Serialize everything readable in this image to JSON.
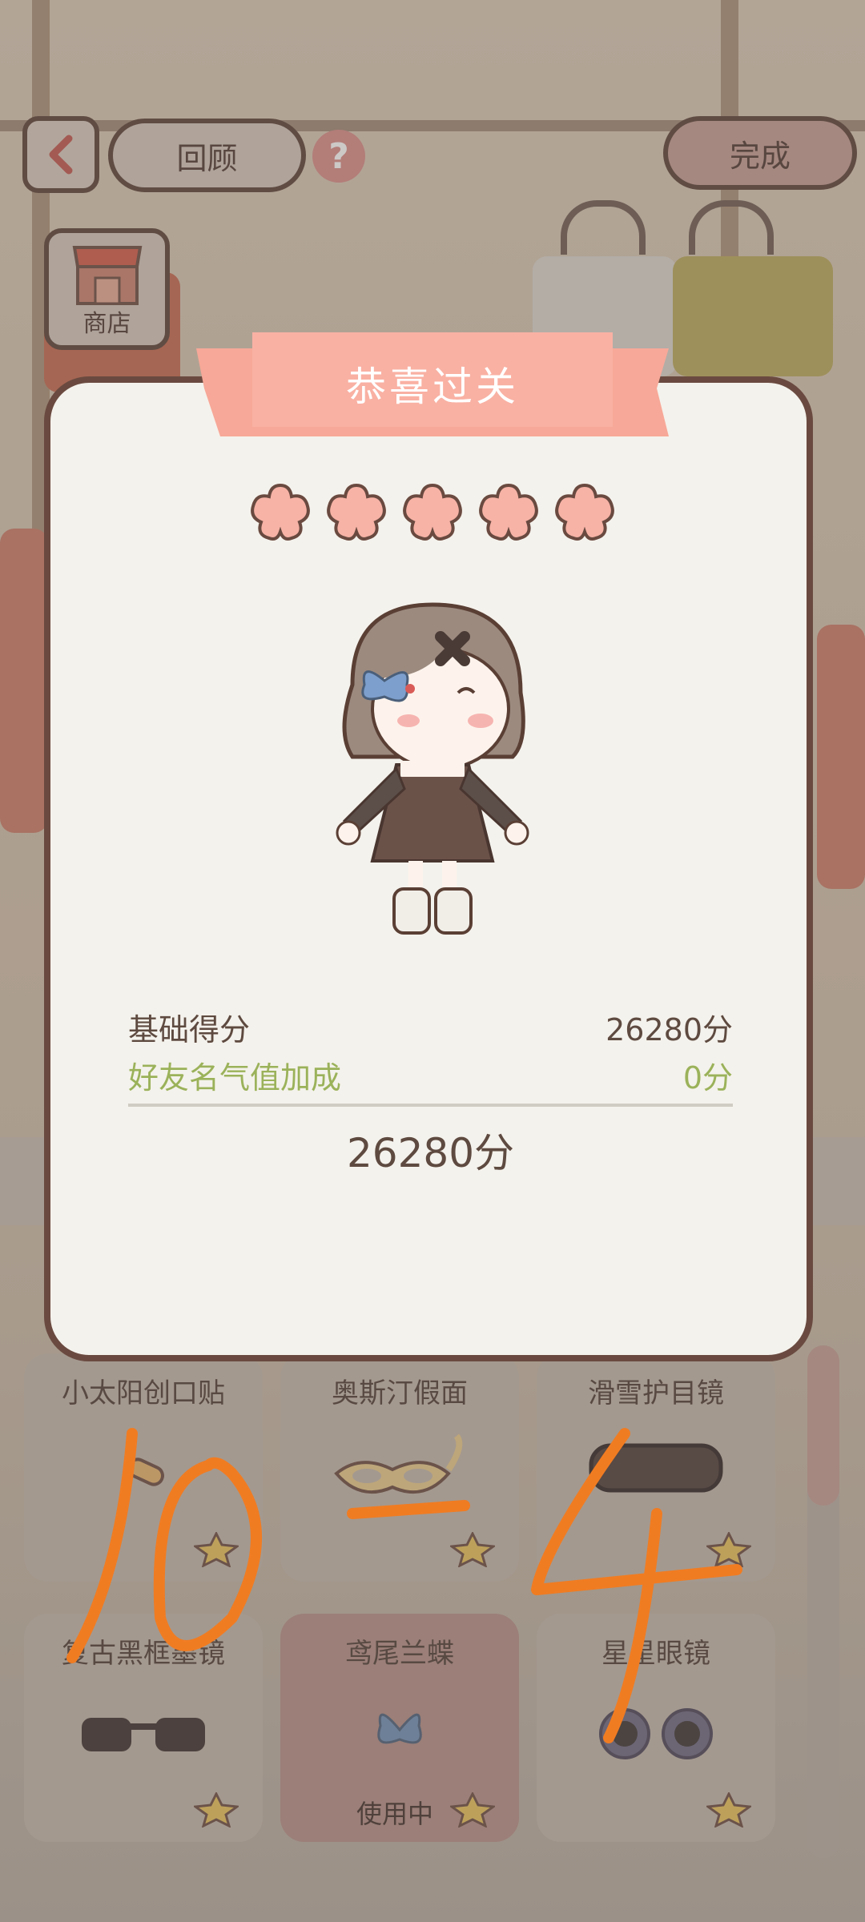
{
  "top_bar": {
    "review_label": "回顾",
    "help_symbol": "?",
    "done_label": "完成",
    "shop_label": "商店"
  },
  "dialog": {
    "title": "恭喜过关",
    "stars_earned": 5,
    "stars_total": 5,
    "base_score_label": "基础得分",
    "base_score_value": "26280分",
    "bonus_label": "好友名气值加成",
    "bonus_value": "0分",
    "total_value": "26280分"
  },
  "items": [
    {
      "name": "小太阳创口贴",
      "status": "",
      "icon": "bandage-icon"
    },
    {
      "name": "奥斯汀假面",
      "status": "",
      "icon": "mask-icon"
    },
    {
      "name": "滑雪护目镜",
      "status": "",
      "icon": "goggles-icon"
    },
    {
      "name": "复古黑框墨镜",
      "status": "",
      "icon": "sunglasses-icon"
    },
    {
      "name": "鸢尾兰蝶",
      "status": "使用中",
      "icon": "butterfly-clip-icon"
    },
    {
      "name": "星星眼镜",
      "status": "",
      "icon": "flower-glasses-icon"
    }
  ],
  "overlay_text": "10-4",
  "colors": {
    "ribbon": "#f7a898",
    "star": "#f7b3a6",
    "bonus_green": "#9bb25a",
    "outline": "#6a4a40",
    "scrawl": "#f07c22"
  }
}
